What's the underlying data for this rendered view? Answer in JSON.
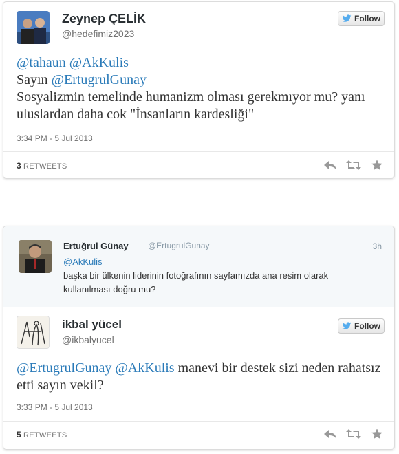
{
  "tweet1": {
    "user_name": "Zeynep ÇELİK",
    "user_handle": "@hedefimiz2023",
    "follow_label": "Follow",
    "mentions": [
      "@tahaun",
      "@AkKulis"
    ],
    "line2_prefix": "Sayın ",
    "line2_mention": "@ErtugrulGunay",
    "body": "Sosyalizmin temelinde humanizm olması gerekmıyor mu? yanı uluslardan daha cok \"İnsanların kardesliği\"",
    "timestamp": "3:34 PM - 5 Jul 2013",
    "retweet_count": "3",
    "retweets_label": "RETWEETS"
  },
  "tweet2": {
    "quoted": {
      "user_name": "Ertuğrul Günay",
      "user_handle": "@ErtugrulGunay",
      "time_ago": "3h",
      "mention": "@AkKulis",
      "body": "başka bir ülkenin liderinin fotoğrafının sayfamızda ana resim olarak kullanılması doğru mu?"
    },
    "user_name": "ikbal yücel",
    "user_handle": "@ikbalyucel",
    "follow_label": "Follow",
    "mentions": [
      "@ErtugrulGunay",
      "@AkKulis"
    ],
    "body": " manevi bir destek sizi neden rahatsız etti sayın vekil?",
    "timestamp": "3:33 PM - 5 Jul 2013",
    "retweet_count": "5",
    "retweets_label": "RETWEETS"
  },
  "icons": [
    "bird-icon",
    "reply-icon",
    "retweet-icon",
    "favorite-icon"
  ],
  "colors": {
    "link": "#2b7bb9",
    "bird": "#55acee",
    "muted": "#707070",
    "icon_gray": "#999999"
  }
}
